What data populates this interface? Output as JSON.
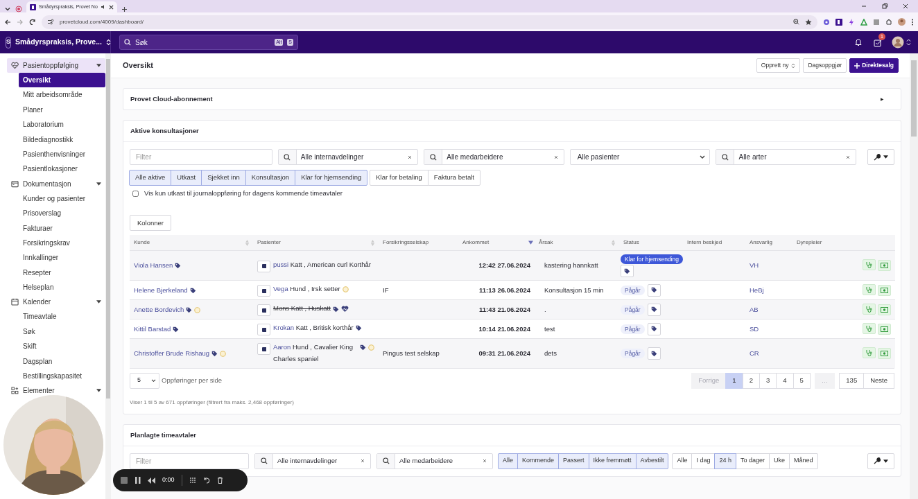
{
  "browser": {
    "tab_title": "Smådyrspraksis, Provet No",
    "url": "provetcloud.com/4009/dashboard/"
  },
  "header": {
    "org_initial": "S",
    "org_name": "Smådyrspraksis, Prove...",
    "search_placeholder": "Søk",
    "shortcut": [
      "Alt",
      "S"
    ],
    "task_count": "1"
  },
  "sidebar": {
    "groups": [
      {
        "label": "Pasientoppfølging",
        "selected": true,
        "expanded": true,
        "children": [
          {
            "label": "Oversikt",
            "selected": true
          },
          {
            "label": "Mitt arbeidsområde",
            "selected": false
          },
          {
            "label": "Planer",
            "selected": false
          },
          {
            "label": "Laboratorium",
            "selected": false
          },
          {
            "label": "Bildediagnostikk",
            "selected": false
          },
          {
            "label": "Pasienthenvisninger",
            "selected": false
          },
          {
            "label": "Pasientlokasjoner",
            "selected": false
          }
        ]
      },
      {
        "label": "Dokumentasjon",
        "selected": false,
        "expanded": true,
        "children": [
          {
            "label": "Kunder og pasienter",
            "selected": false
          },
          {
            "label": "Prisoverslag",
            "selected": false
          },
          {
            "label": "Fakturaer",
            "selected": false
          },
          {
            "label": "Forsikringskrav",
            "selected": false
          },
          {
            "label": "Innkallinger",
            "selected": false
          },
          {
            "label": "Resepter",
            "selected": false
          },
          {
            "label": "Helseplan",
            "selected": false
          }
        ]
      },
      {
        "label": "Kalender",
        "selected": false,
        "expanded": true,
        "children": [
          {
            "label": "Timeavtale",
            "selected": false
          },
          {
            "label": "Søk",
            "selected": false
          },
          {
            "label": "Skift",
            "selected": false
          },
          {
            "label": "Dagsplan",
            "selected": false
          },
          {
            "label": "Bestillingskapasitet",
            "selected": false
          }
        ]
      },
      {
        "label": "Elementer",
        "selected": false,
        "expanded": true
      }
    ]
  },
  "page": {
    "title": "Oversikt",
    "buttons": [
      {
        "label": "Opprett ny",
        "kind": "dropdown"
      },
      {
        "label": "Dagsoppgjør",
        "kind": "plain"
      },
      {
        "label": "Direktesalg",
        "kind": "primary"
      }
    ]
  },
  "subscription": {
    "title": "Provet Cloud-abonnement",
    "expanded": false
  },
  "consultations": {
    "title": "Aktive konsultasjoner",
    "filter_placeholder": "Filter",
    "filters": [
      {
        "kind": "search",
        "value": "Alle internavdelinger"
      },
      {
        "kind": "search",
        "value": "Alle medarbeidere"
      },
      {
        "kind": "select",
        "value": "Alle pasienter"
      },
      {
        "kind": "search",
        "value": "Alle arter"
      }
    ],
    "button_groups": [
      [
        {
          "label": "Alle aktive",
          "selected": true
        },
        {
          "label": "Utkast",
          "selected": true
        },
        {
          "label": "Sjekket inn",
          "selected": true
        },
        {
          "label": "Konsultasjon",
          "selected": true
        },
        {
          "label": "Klar for hjemsending",
          "selected": true
        }
      ],
      [
        {
          "label": "Klar for betaling",
          "selected": false
        },
        {
          "label": "Faktura betalt",
          "selected": false
        }
      ]
    ],
    "checkbox": {
      "label": "Vis kun utkast til journaloppføring for dagens kommende timeavtaler",
      "checked": false
    },
    "columns_button": "Kolonner",
    "columns": [
      {
        "label": "Kunde",
        "sortable": true,
        "sorted": false
      },
      {
        "label": "Pasienter",
        "sortable": true,
        "sorted": false
      },
      {
        "label": "Forsikringsselskap",
        "sortable": false,
        "sorted": false
      },
      {
        "label": "Ankommet",
        "sortable": false,
        "sorted": true
      },
      {
        "label": "Årsak",
        "sortable": true,
        "sorted": false
      },
      {
        "label": "Status",
        "sortable": false,
        "sorted": false
      },
      {
        "label": "Intern beskjed",
        "sortable": false,
        "sorted": false
      },
      {
        "label": "Ansvarlig",
        "sortable": false,
        "sorted": false
      },
      {
        "label": "Dyrepleier",
        "sortable": false,
        "sorted": false
      }
    ],
    "rows": [
      {
        "customer": "Viola Hansen",
        "customer_tagged": true,
        "customer_warning": false,
        "patient_name": "pussi",
        "patient_desc": "Katt , American curl Korthår",
        "patient_tagged": false,
        "patient_warning": false,
        "patient_insured": false,
        "deceased": false,
        "insurance": "",
        "arrived": "12:42 27.06.2024",
        "reason": "kastering hannkatt",
        "status": {
          "label": "Klar for hjemsending",
          "kind": "ready"
        },
        "responsible": "VH"
      },
      {
        "customer": "Helene Bjerkeland",
        "customer_tagged": true,
        "customer_warning": false,
        "patient_name": "Vega",
        "patient_desc": "Hund , Irsk setter",
        "patient_tagged": false,
        "patient_warning": true,
        "patient_insured": false,
        "deceased": false,
        "insurance": "IF",
        "arrived": "11:13 26.06.2024",
        "reason": "Konsultasjon 15 min",
        "status": {
          "label": "Pågår",
          "kind": "ongoing"
        },
        "responsible": "HeBj"
      },
      {
        "customer": "Anette Bordevich",
        "customer_tagged": true,
        "customer_warning": true,
        "patient_name": "Mons",
        "patient_desc": "Katt , Huskatt",
        "patient_tagged": true,
        "patient_warning": false,
        "patient_insured": true,
        "deceased": true,
        "insurance": "",
        "arrived": "11:43 21.06.2024",
        "reason": ".",
        "status": {
          "label": "Pågår",
          "kind": "ongoing"
        },
        "responsible": "AB"
      },
      {
        "customer": "Kittil Barstad",
        "customer_tagged": true,
        "customer_warning": false,
        "patient_name": "Krokan",
        "patient_desc": "Katt , Britisk korthår",
        "patient_tagged": true,
        "patient_warning": false,
        "patient_insured": false,
        "deceased": false,
        "insurance": "",
        "arrived": "10:14 21.06.2024",
        "reason": "test",
        "status": {
          "label": "Pågår",
          "kind": "ongoing"
        },
        "responsible": "SD"
      },
      {
        "customer": "Christoffer Brude Rishaug",
        "customer_tagged": true,
        "customer_warning": true,
        "patient_name": "Aaron",
        "patient_desc": "Hund , Cavalier King Charles spaniel",
        "patient_tagged": true,
        "patient_warning": true,
        "patient_insured": false,
        "deceased": false,
        "insurance": "Pingus test selskap",
        "arrived": "09:31 21.06.2024",
        "reason": "dets",
        "status": {
          "label": "Pågår",
          "kind": "ongoing"
        },
        "responsible": "CR"
      }
    ],
    "page_size": "5",
    "page_size_label": "Oppføringer per side",
    "pagination": [
      {
        "label": "Forrige",
        "selected": false,
        "disabled": true
      },
      {
        "label": "1",
        "selected": true,
        "disabled": false
      },
      {
        "label": "2",
        "selected": false,
        "disabled": false
      },
      {
        "label": "3",
        "selected": false,
        "disabled": false
      },
      {
        "label": "4",
        "selected": false,
        "disabled": false
      },
      {
        "label": "5",
        "selected": false,
        "disabled": false
      },
      {
        "label": "…",
        "selected": false,
        "disabled": true
      },
      {
        "label": "135",
        "selected": false,
        "disabled": false
      },
      {
        "label": "Neste",
        "selected": false,
        "disabled": false
      }
    ],
    "info": "Viser 1 til 5 av 671 oppføringer (filtrert fra maks. 2,468 oppføringer)"
  },
  "appointments": {
    "title": "Planlagte timeavtaler",
    "filter_placeholder": "Filter",
    "filters": [
      {
        "kind": "search",
        "value": "Alle internavdelinger"
      },
      {
        "kind": "search",
        "value": "Alle medarbeidere"
      }
    ],
    "button_groups": [
      [
        {
          "label": "Alle",
          "selected": true
        },
        {
          "label": "Kommende",
          "selected": true
        },
        {
          "label": "Passert",
          "selected": true
        },
        {
          "label": "Ikke fremmøtt",
          "selected": true
        },
        {
          "label": "Avbestilt",
          "selected": true
        }
      ],
      [
        {
          "label": "Alle",
          "selected": false
        },
        {
          "label": "I dag",
          "selected": false
        },
        {
          "label": "24 h",
          "selected": true
        },
        {
          "label": "To dager",
          "selected": false
        },
        {
          "label": "Uke",
          "selected": false
        },
        {
          "label": "Måned",
          "selected": false
        }
      ]
    ]
  },
  "recorder": {
    "time": "0:00"
  }
}
